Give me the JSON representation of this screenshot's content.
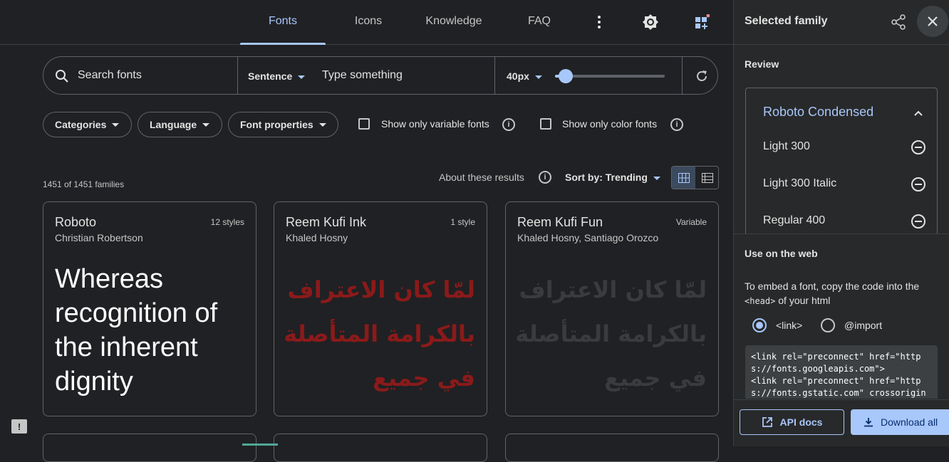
{
  "nav": {
    "tabs": [
      {
        "label": "Fonts",
        "active": true
      },
      {
        "label": "Icons",
        "active": false
      },
      {
        "label": "Knowledge",
        "active": false
      },
      {
        "label": "FAQ",
        "active": false
      }
    ],
    "icons": [
      "more-vert-icon",
      "brightness-icon",
      "selected-families-icon"
    ]
  },
  "search": {
    "placeholder": "Search fonts",
    "preview_mode": "Sentence",
    "preview_placeholder": "Type something",
    "size": "40px",
    "slider_level": 0.1
  },
  "filters": {
    "chips": [
      "Categories",
      "Language",
      "Font properties"
    ],
    "checkboxes": [
      {
        "label": "Show only variable fonts",
        "checked": false
      },
      {
        "label": "Show only color fonts",
        "checked": false
      }
    ]
  },
  "results": {
    "count": "1451 of 1451 families",
    "about": "About these results",
    "sort": "Sort by: Trending",
    "view": "grid"
  },
  "cards": [
    {
      "name": "Roboto",
      "author": "Christian Robertson",
      "styles": "12 styles",
      "sample": "Whereas recognition of the inherent dignity"
    },
    {
      "name": "Reem Kufi Ink",
      "author": "Khaled Hosny",
      "styles": "1 style",
      "sample": "لمّا كان الاعتراف بالكرامة المتأصلة في جميع"
    },
    {
      "name": "Reem Kufi Fun",
      "author": "Khaled Hosny, Santiago Orozco",
      "styles": "Variable",
      "sample": "لمّا كان الاعتراف بالكرامة المتأصلة في جميع"
    }
  ],
  "panel": {
    "title": "Selected family",
    "review_title": "Review",
    "family": "Roboto Condensed",
    "styles": [
      "Light 300",
      "Light 300 Italic",
      "Regular 400"
    ],
    "web_title": "Use on the web",
    "embed_text_1": "To embed a font, copy the code into the",
    "embed_code_tag": "<head>",
    "embed_text_2": "of your html",
    "radio_link": "<link>",
    "radio_import": "@import",
    "code_lines": [
      "<link rel=\"preconnect\" href=\"http",
      "s://fonts.googleapis.com\">",
      "<link rel=\"preconnect\" href=\"http",
      "s://fonts.gstatic.com\" crossorigin"
    ],
    "api_docs": "API docs",
    "download_all": "Download all"
  },
  "colors": {
    "background": "#202124",
    "accent": "#a8c7fa",
    "ink_sample": "#8b1a1a",
    "fun_sample": "#3a3b3e",
    "notification_dot": "#f28b82"
  }
}
